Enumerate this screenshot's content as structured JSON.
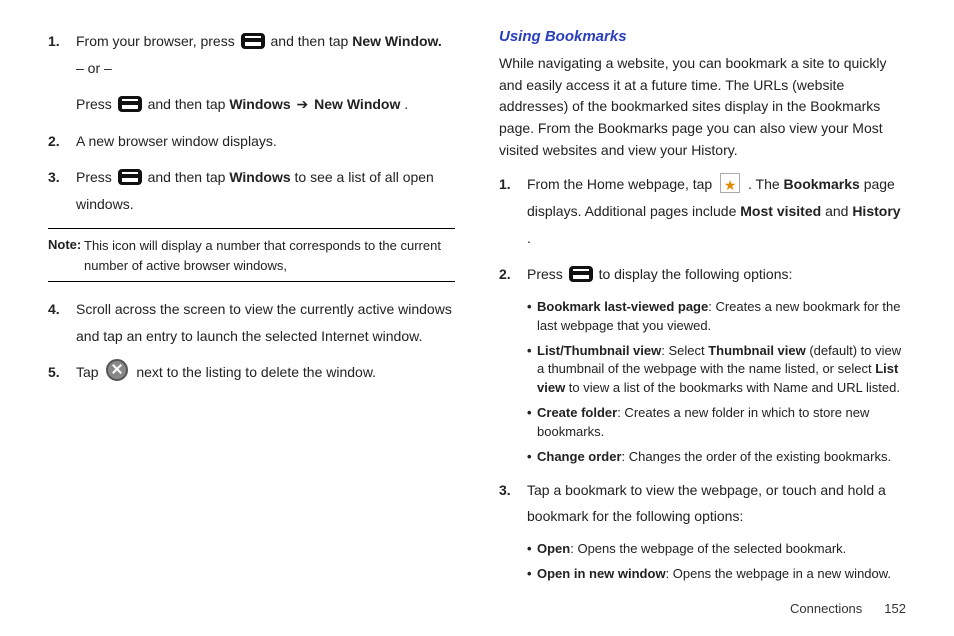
{
  "left": {
    "step1": {
      "num": "1.",
      "t1": "From your browser, press ",
      "t2": " and then tap ",
      "b1": "New Window.",
      "or": "– or –",
      "t3": "Press ",
      "t4": " and then tap ",
      "b2": "Windows",
      "arrow": " ➔ ",
      "b3": "New Window",
      "t5": "."
    },
    "step2": {
      "num": "2.",
      "t": "A new browser window displays."
    },
    "step3": {
      "num": "3.",
      "t1": "Press ",
      "t2": " and then tap ",
      "b1": "Windows",
      "t3": " to see a list of all open windows."
    },
    "note": {
      "label": "Note:",
      "body": "This icon will display a number that corresponds to the current number of active browser windows,"
    },
    "step4": {
      "num": "4.",
      "t": "Scroll across the screen to view the currently active windows and tap an entry to launch the selected Internet window."
    },
    "step5": {
      "num": "5.",
      "t1": "Tap ",
      "t2": " next to the listing to delete the window."
    }
  },
  "right": {
    "heading": "Using Bookmarks",
    "intro": "While navigating a website, you can bookmark a site to quickly and easily access it at a future time. The URLs (website addresses) of the bookmarked sites display in the Bookmarks page. From the Bookmarks page you can also view your Most visited websites and view your History.",
    "step1": {
      "num": "1.",
      "t1": "From the Home webpage, tap ",
      "t2": " . The ",
      "b1": "Bookmarks",
      "t3": " page displays. Additional pages include ",
      "b2": "Most visited",
      "t4": " and ",
      "b3": "History",
      "t5": "."
    },
    "step2": {
      "num": "2.",
      "t1": "Press ",
      "t2": " to display the following options:"
    },
    "bullets2": [
      {
        "b": "Bookmark last-viewed page",
        "t": ": Creates a new bookmark for the last webpage that you viewed."
      },
      {
        "b": "List/Thumbnail view",
        "t": ": Select ",
        "b2": "Thumbnail view",
        "t2": " (default) to view a thumbnail of the webpage with the name listed, or select ",
        "b3": "List view",
        "t3": " to view a list of the bookmarks with Name and URL listed."
      },
      {
        "b": "Create folder",
        "t": ": Creates a new folder in which to store new bookmarks."
      },
      {
        "b": "Change order",
        "t": ": Changes the order of the existing bookmarks."
      }
    ],
    "step3": {
      "num": "3.",
      "t": "Tap a bookmark to view the webpage, or touch and hold a bookmark for the following options:"
    },
    "bullets3": [
      {
        "b": "Open",
        "t": ": Opens the webpage of the selected bookmark."
      },
      {
        "b": "Open in new window",
        "t": ": Opens the webpage in a new window."
      }
    ]
  },
  "footer": {
    "section": "Connections",
    "page": "152"
  }
}
